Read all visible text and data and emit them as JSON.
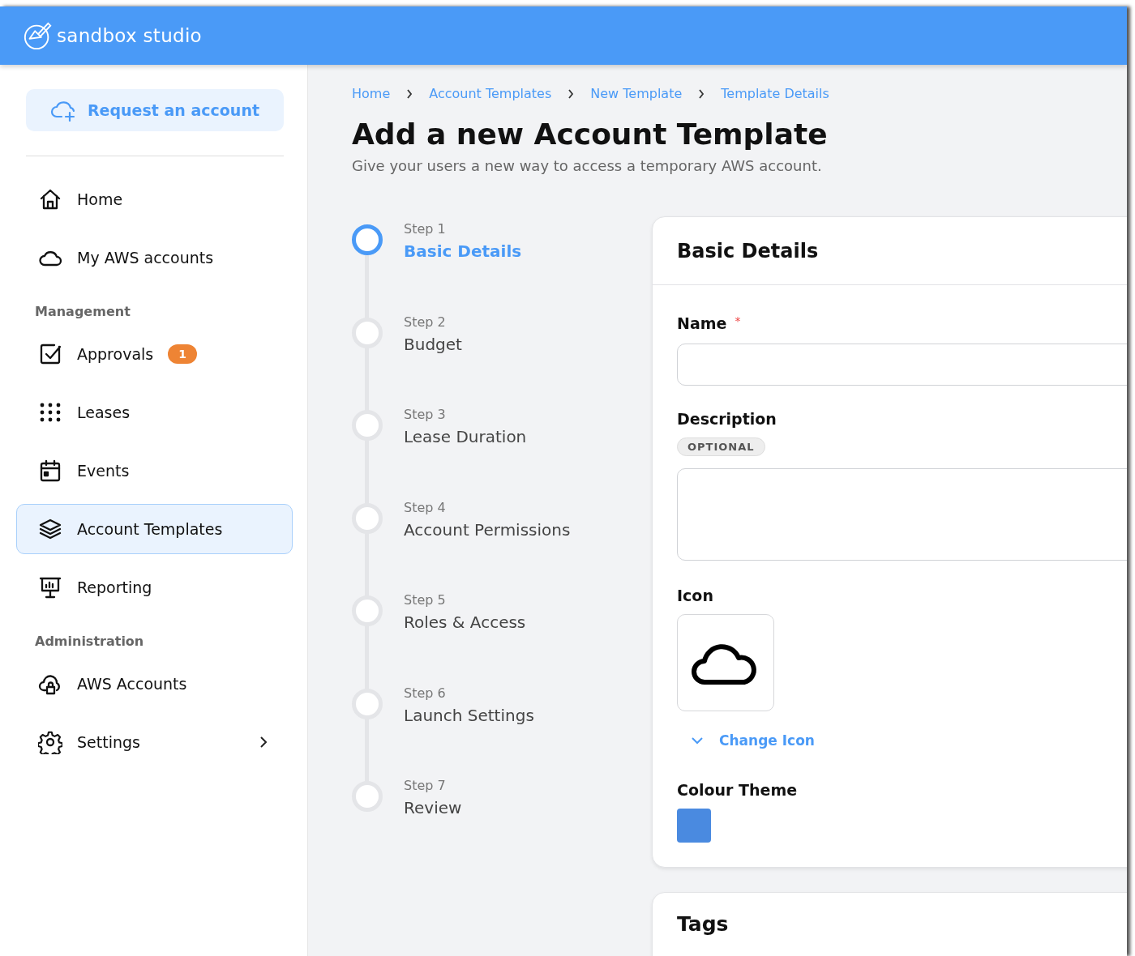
{
  "app": {
    "brand": "sandbox studio"
  },
  "sidebar": {
    "request_button": "Request an account",
    "items": [
      {
        "kind": "link",
        "label": "Home",
        "selected": false,
        "expandable": false
      },
      {
        "kind": "link",
        "label": "My AWS accounts",
        "selected": false,
        "expandable": false
      },
      {
        "kind": "section",
        "label": "Management"
      },
      {
        "kind": "link",
        "label": "Approvals",
        "badge": "1",
        "selected": false,
        "expandable": false
      },
      {
        "kind": "link",
        "label": "Leases",
        "selected": false,
        "expandable": false
      },
      {
        "kind": "link",
        "label": "Events",
        "selected": false,
        "expandable": false
      },
      {
        "kind": "link",
        "label": "Account Templates",
        "selected": true,
        "expandable": false
      },
      {
        "kind": "link",
        "label": "Reporting",
        "selected": false,
        "expandable": false
      },
      {
        "kind": "section",
        "label": "Administration"
      },
      {
        "kind": "link",
        "label": "AWS Accounts",
        "selected": false,
        "expandable": false
      },
      {
        "kind": "link",
        "label": "Settings",
        "selected": false,
        "expandable": true
      }
    ]
  },
  "breadcrumbs": [
    "Home",
    "Account Templates",
    "New Template",
    "Template Details"
  ],
  "page": {
    "title": "Add a new Account Template",
    "subtitle": "Give your users a new way to access a temporary AWS account."
  },
  "steps": [
    {
      "step": "Step 1",
      "label": "Basic Details",
      "selected": true
    },
    {
      "step": "Step 2",
      "label": "Budget",
      "selected": false
    },
    {
      "step": "Step 3",
      "label": "Lease Duration",
      "selected": false
    },
    {
      "step": "Step 4",
      "label": "Account Permissions",
      "selected": false
    },
    {
      "step": "Step 5",
      "label": "Roles & Access",
      "selected": false
    },
    {
      "step": "Step 6",
      "label": "Launch Settings",
      "selected": false
    },
    {
      "step": "Step 7",
      "label": "Review",
      "selected": false
    }
  ],
  "form": {
    "title": "Basic Details",
    "name": {
      "label": "Name",
      "required_mark": "*"
    },
    "description": {
      "label": "Description",
      "tag": "OPTIONAL"
    },
    "icon": {
      "label": "Icon",
      "change_link": "Change Icon"
    },
    "colour_theme": {
      "label": "Colour Theme",
      "color": "#4a8ae0"
    }
  },
  "tags_card": {
    "title": "Tags"
  }
}
